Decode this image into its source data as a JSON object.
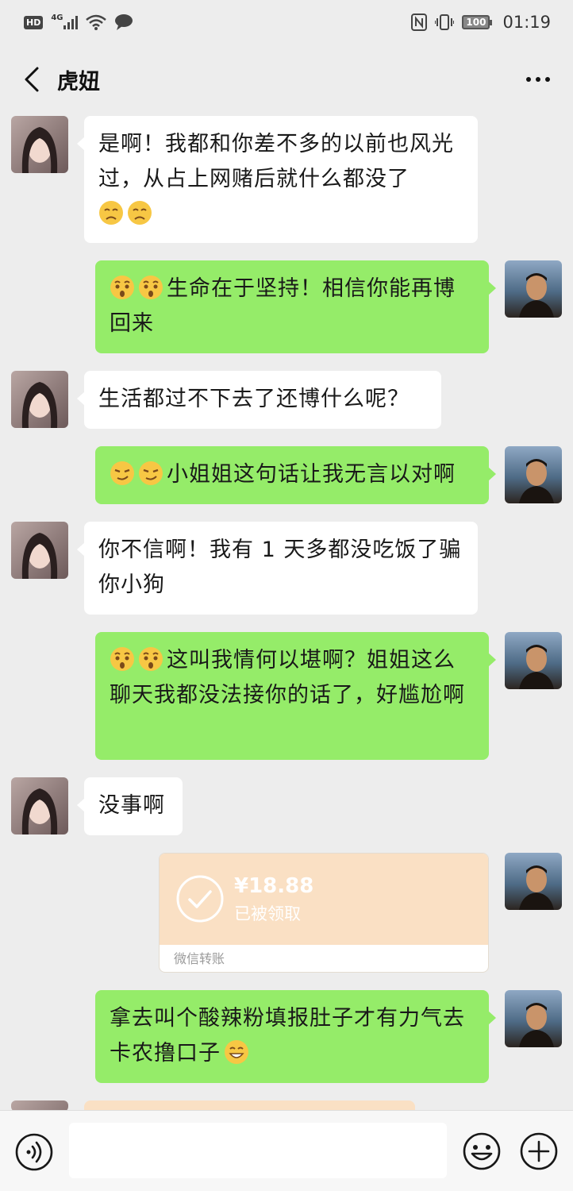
{
  "status_bar": {
    "hd": "HD",
    "network": "4G",
    "battery": "100",
    "time": "01:19"
  },
  "header": {
    "title": "虎妞"
  },
  "messages": [
    {
      "side": "left",
      "text": "是啊！我都和你差不多的以前也风光过，从占上网赌后就什么都没了",
      "emojis": [
        "sad-face",
        "sad-face"
      ]
    },
    {
      "side": "right",
      "lead_emojis": [
        "surprised-face",
        "surprised-face"
      ],
      "text": "生命在于坚持！相信你能再博回来"
    },
    {
      "side": "left",
      "text": "生活都过不下去了还博什么呢？"
    },
    {
      "side": "right",
      "lead_emojis": [
        "smirk-face",
        "smirk-face"
      ],
      "text": "小姐姐这句话让我无言以对啊"
    },
    {
      "side": "left",
      "text": "你不信啊！我有 1 天多都没吃饭了骗你小狗"
    },
    {
      "side": "right",
      "lead_emojis": [
        "surprised-face",
        "surprised-face"
      ],
      "text": "这叫我情何以堪啊？姐姐这么聊天我都没法接你的话了，好尴尬啊"
    },
    {
      "side": "left",
      "text": "没事啊"
    },
    {
      "side": "right",
      "type": "transfer",
      "amount": "¥18.88",
      "status": "已被领取",
      "label": "微信转账"
    },
    {
      "side": "right",
      "text": "拿去叫个酸辣粉填报肚子才有力气去卡农撸口子",
      "trail_emojis": [
        "grin-face"
      ]
    }
  ],
  "input_bar": {
    "placeholder": ""
  },
  "colors": {
    "background": "#ededed",
    "bubble_self": "#95ec69",
    "bubble_other": "#ffffff",
    "transfer": "#fae0c4"
  }
}
